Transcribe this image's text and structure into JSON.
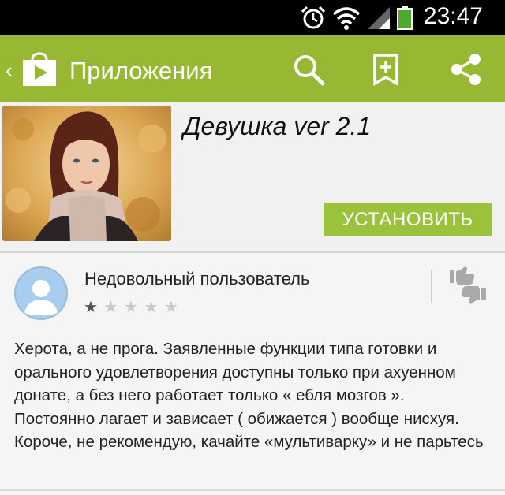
{
  "status_bar": {
    "time": "23:47"
  },
  "action_bar": {
    "title": "Приложения"
  },
  "app": {
    "name": "Девушка ver 2.1",
    "install_label": "УСТАНОВИТЬ"
  },
  "review": {
    "author": "Недовольный пользователь",
    "rating": 1,
    "max_rating": 5,
    "stars": [
      "★",
      "★",
      "★",
      "★",
      "★"
    ],
    "lines": [
      "Херота, а не прога. Заявленные функции типа готовки и",
      "орального удовлетворения доступны только при ахуенном",
      "донате, а без него работает только « ебля мозгов ».",
      "Постоянно лагает и зависает ( обижается ) вообще нисхуя.",
      "Короче, не рекомендую, качайте «мультиварку» и не парьтесь"
    ]
  },
  "colors": {
    "action_bar": "#97b832",
    "install_button": "#9ac23c",
    "status_bar": "#000000"
  },
  "icons": [
    "alarm-icon",
    "wifi-icon",
    "signal-icon",
    "battery-icon",
    "back-icon",
    "play-store-icon",
    "search-icon",
    "wishlist-icon",
    "share-icon",
    "thumbs-icon"
  ]
}
